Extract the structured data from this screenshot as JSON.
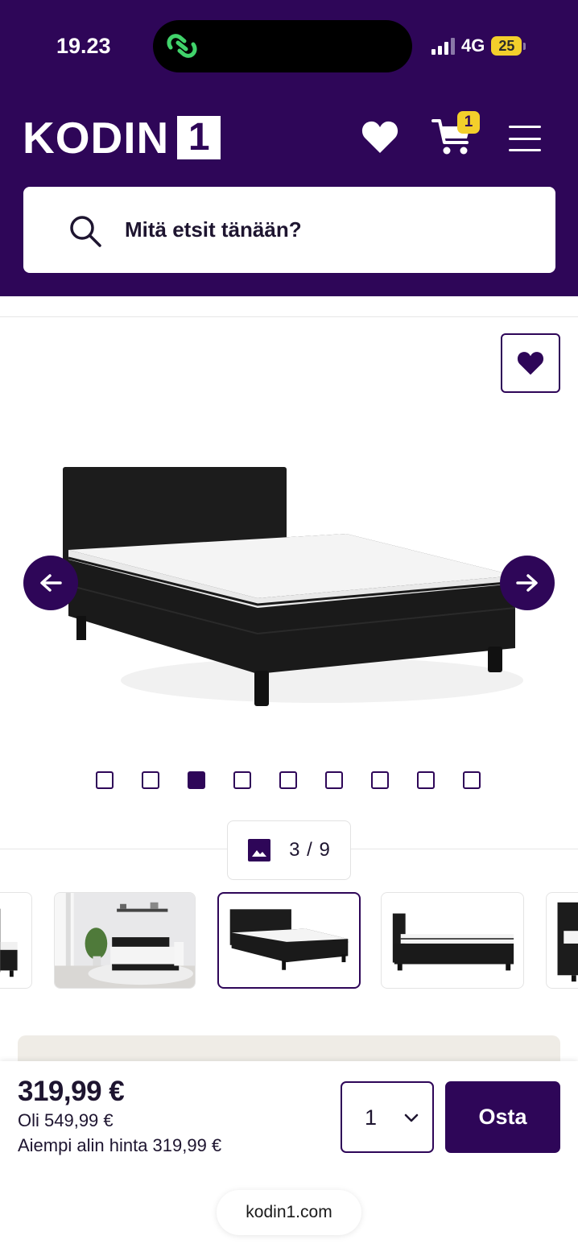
{
  "status_bar": {
    "time": "19.23",
    "network": "4G",
    "battery": "25"
  },
  "header": {
    "logo_text": "KODIN",
    "logo_badge": "1",
    "cart_count": "1",
    "search_placeholder": "Mitä etsit tänään?"
  },
  "gallery": {
    "counter": "3 / 9",
    "total_images": 9,
    "active_index": 3,
    "thumbnails": [
      "bed-side-view",
      "bedroom-scene",
      "bed-angle-view",
      "bed-front-view",
      "bed-partial-view"
    ]
  },
  "purchase": {
    "price": "319,99 €",
    "was_price": "Oli 549,99 €",
    "lowest_price": "Aiempi alin hinta 319,99 €",
    "quantity": "1",
    "buy_label": "Osta"
  },
  "browser": {
    "url": "kodin1.com"
  },
  "colors": {
    "brand": "#2e0658",
    "accent": "#f3cf2b",
    "card_bg": "#efece6"
  }
}
